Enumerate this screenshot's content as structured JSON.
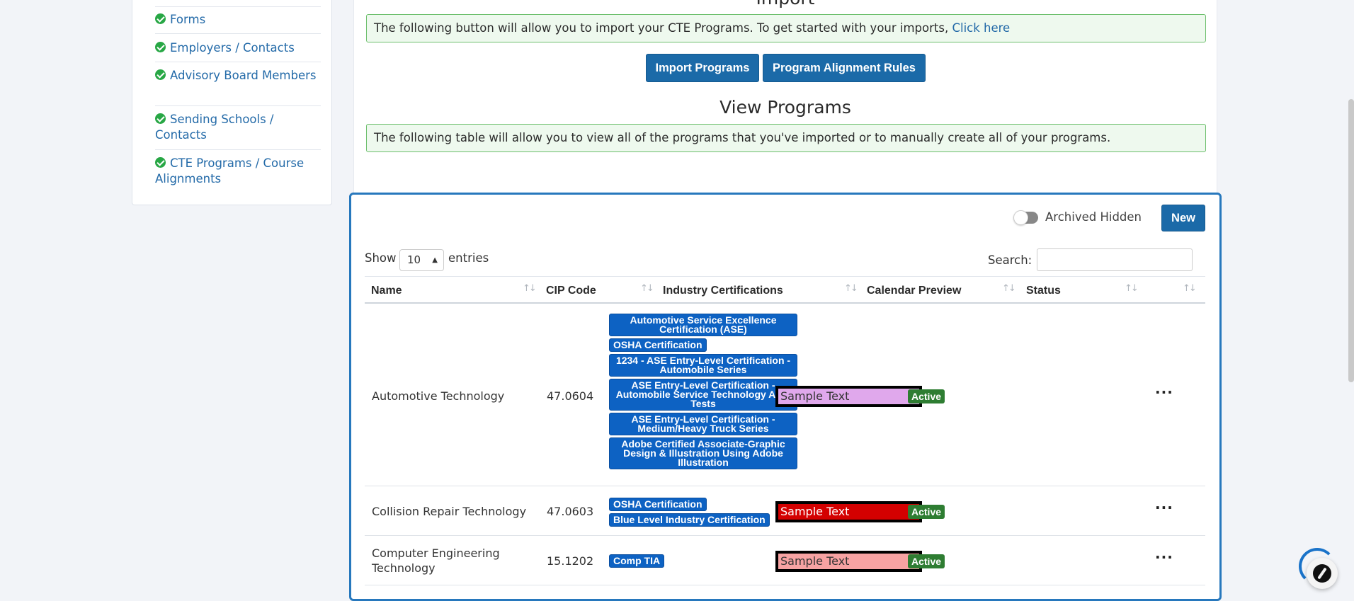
{
  "sidebar": {
    "items": [
      {
        "label": "Forms"
      },
      {
        "label": "Employers / Contacts"
      },
      {
        "label": "Advisory Board Members"
      },
      {
        "label": "Sending Schools / Contacts"
      },
      {
        "label": "CTE Programs / Course Alignments"
      }
    ]
  },
  "import_section": {
    "title": "Import",
    "alert_text": "The following button will allow you to import your CTE Programs. To get started with your imports,",
    "alert_link": "Click here",
    "import_button": "Import Programs",
    "rules_button": "Program Alignment Rules"
  },
  "view_section": {
    "title": "View Programs",
    "alert_text": "The following table will allow you to view all of the programs that you've imported or to manually create all of your programs."
  },
  "table_controls": {
    "archived_label": "Archived Hidden",
    "new_button": "New",
    "show_label": "Show",
    "show_value": "10",
    "entries_label": "entries",
    "search_label": "Search:",
    "search_value": ""
  },
  "table": {
    "headers": [
      "Name",
      "CIP Code",
      "Industry Certifications",
      "Calendar Preview",
      "Status"
    ],
    "rows": [
      {
        "name": "Automotive Technology",
        "cip": "47.0604",
        "certs": [
          "Automotive Service Excellence Certification (ASE)",
          "OSHA Certification",
          "1234 - ASE Entry-Level Certification - Automobile Series",
          "ASE Entry-Level Certification - Automobile Service Technology Area Tests",
          "ASE Entry-Level Certification - Medium/Heavy Truck Series",
          "Adobe Certified Associate-Graphic Design & Illustration Using Adobe Illustration"
        ],
        "preview_text": "Sample Text",
        "preview_color": "#e0a8ec",
        "preview_text_color": "#333333",
        "status": "Active",
        "actions": "···"
      },
      {
        "name": "Collision Repair Technology",
        "cip": "47.0603",
        "certs": [
          "OSHA Certification",
          "Blue Level Industry Certification"
        ],
        "preview_text": "Sample Text",
        "preview_color": "#d40000",
        "preview_text_color": "#ffffff",
        "status": "Active",
        "actions": "···"
      },
      {
        "name": "Computer Engineering Technology",
        "cip": "15.1202",
        "certs": [
          "Comp TIA"
        ],
        "preview_text": "Sample Text",
        "preview_color": "#f7a3a3",
        "preview_text_color": "#333333",
        "status": "Active",
        "actions": "···"
      }
    ]
  },
  "colors": {
    "primary": "#1b6aa8",
    "panel_border": "#2778bd",
    "cert_badge": "#0d62c3",
    "status_active": "#2e7d32",
    "check": "#28a745"
  }
}
